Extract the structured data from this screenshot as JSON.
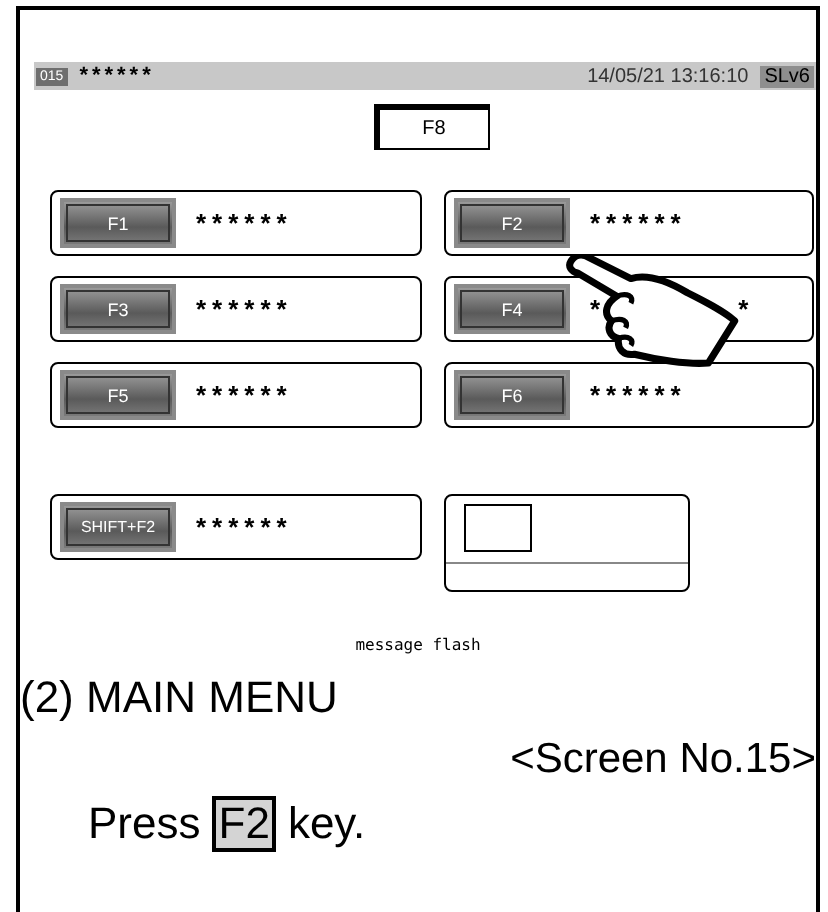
{
  "status_bar": {
    "screen_code": "015",
    "title": "******",
    "datetime": "14/05/21 13:16:10",
    "level": "SLv6"
  },
  "top_button": "F8",
  "menu": [
    {
      "key": "F1",
      "label": "******"
    },
    {
      "key": "F2",
      "label": "******"
    },
    {
      "key": "F3",
      "label": "******"
    },
    {
      "key": "F4",
      "label": "*",
      "label_tail": "*"
    },
    {
      "key": "F5",
      "label": "******"
    },
    {
      "key": "F6",
      "label": "******"
    }
  ],
  "shift_item": {
    "key": "SHIFT+F2",
    "label": "******"
  },
  "message": "message flash",
  "caption": {
    "heading": "(2) MAIN MENU",
    "screen": "<Screen No.15>",
    "before": "Press",
    "key": "F2",
    "after": "key."
  }
}
